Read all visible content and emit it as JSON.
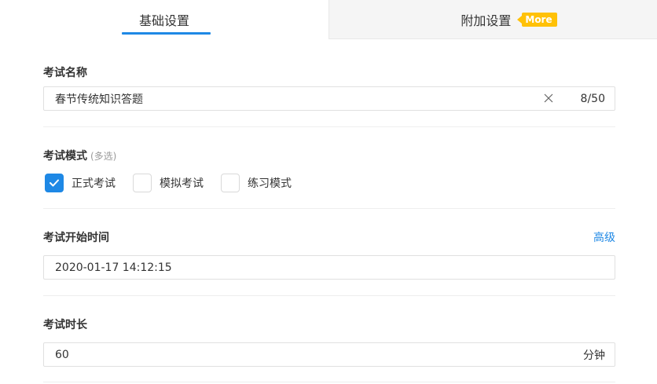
{
  "tabs": {
    "basic_label": "基础设置",
    "extra_label": "附加设置",
    "more_badge": "More",
    "accent_color": "#1e88e5",
    "badge_color": "#ffc107"
  },
  "exam_name": {
    "label": "考试名称",
    "value": "春节传统知识答题",
    "char_count": "8/50",
    "clear_icon": "close-icon"
  },
  "exam_mode": {
    "label": "考试模式",
    "hint": "(多选)",
    "options": [
      {
        "label": "正式考试",
        "checked": true
      },
      {
        "label": "模拟考试",
        "checked": false
      },
      {
        "label": "练习模式",
        "checked": false
      }
    ]
  },
  "start_time": {
    "label": "考试开始时间",
    "advanced_link": "高级",
    "value": "2020-01-17 14:12:15"
  },
  "duration": {
    "label": "考试时长",
    "value": "60",
    "unit": "分钟"
  }
}
